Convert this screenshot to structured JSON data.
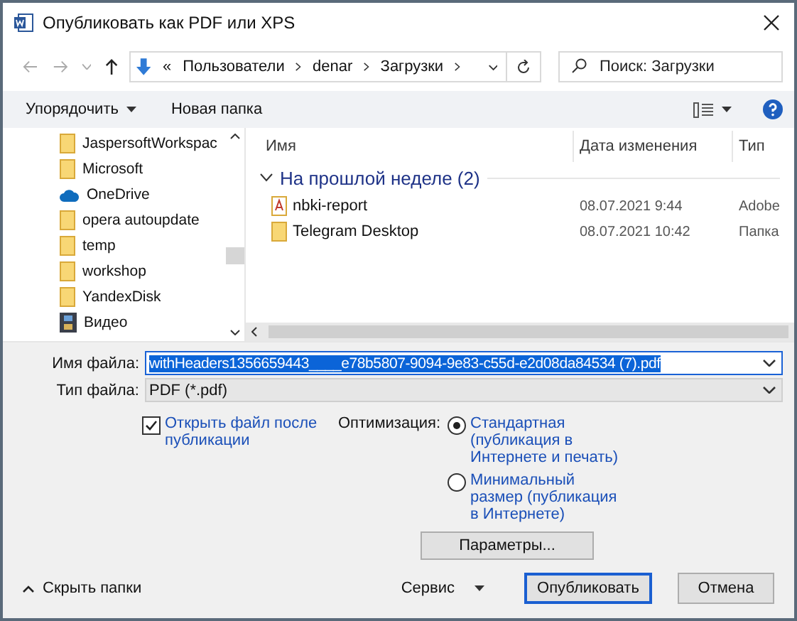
{
  "window": {
    "title": "Опубликовать как PDF или XPS"
  },
  "address": {
    "overflow": "«",
    "segments": [
      "Пользователи",
      "denar",
      "Загрузки"
    ]
  },
  "search": {
    "placeholder": "Поиск: Загрузки"
  },
  "toolbar": {
    "organize": "Упорядочить",
    "new_folder": "Новая папка"
  },
  "sidebar": {
    "items": [
      {
        "label": "JaspersoftWorkspac",
        "kind": "folder"
      },
      {
        "label": "Microsoft",
        "kind": "folder"
      },
      {
        "label": "OneDrive",
        "kind": "cloud"
      },
      {
        "label": "opera autoupdate",
        "kind": "folder"
      },
      {
        "label": "temp",
        "kind": "folder"
      },
      {
        "label": "workshop",
        "kind": "folder"
      },
      {
        "label": "YandexDisk",
        "kind": "folder"
      },
      {
        "label": "Видео",
        "kind": "video"
      }
    ]
  },
  "file_list": {
    "columns": [
      "Имя",
      "Дата изменения",
      "Тип"
    ],
    "group": "На прошлой неделе (2)",
    "rows": [
      {
        "name": "nbki-report",
        "date": "08.07.2021 9:44",
        "type": "Adobe",
        "kind": "pdf"
      },
      {
        "name": "Telegram Desktop",
        "date": "08.07.2021 10:42",
        "type": "Папка",
        "kind": "folder"
      }
    ]
  },
  "filename": {
    "label": "Имя файла:",
    "value": "withHeaders1356659443____e78b5807-9094-9e83-c55d-e2d08da84534 (7).pdf"
  },
  "filetype": {
    "label": "Тип файла:",
    "value": "PDF (*.pdf)"
  },
  "open_after": {
    "label": "Открыть файл после публикации",
    "checked": true
  },
  "optimization": {
    "label": "Оптимизация:",
    "options": [
      {
        "label": "Стандартная (публикация в Интернете и печать)",
        "selected": true
      },
      {
        "label": "Минимальный размер (публикация в Интернете)",
        "selected": false
      }
    ]
  },
  "options_button": "Параметры...",
  "hide_folders": "Скрыть папки",
  "tools": "Сервис",
  "buttons": [
    "Опубликовать",
    "Отмена"
  ]
}
